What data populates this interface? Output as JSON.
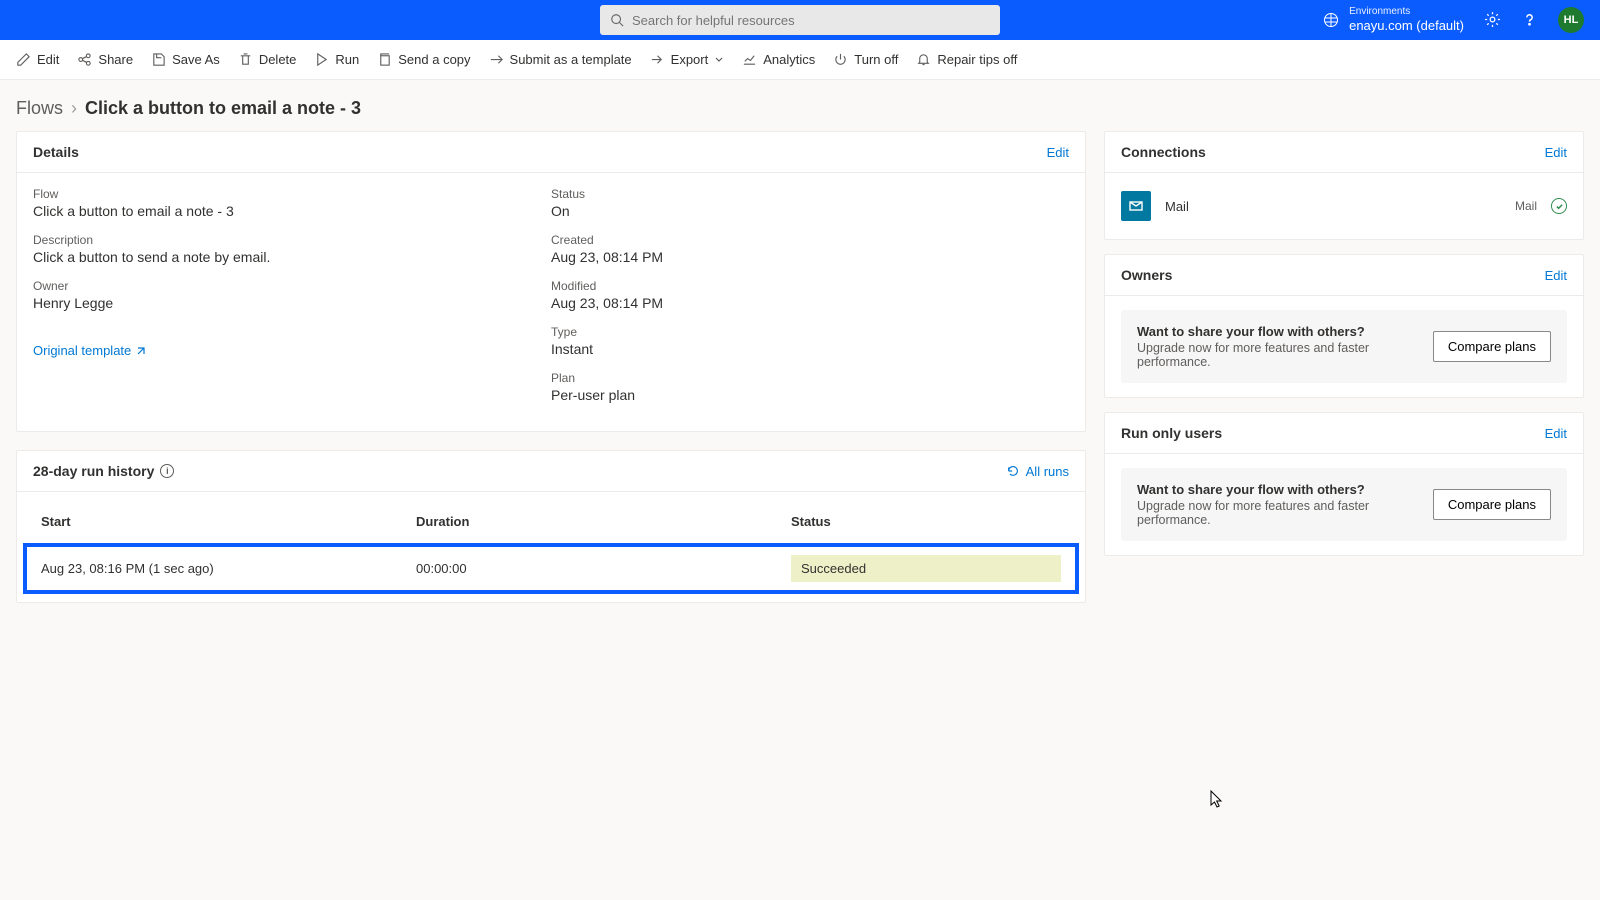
{
  "topbar": {
    "search_placeholder": "Search for helpful resources",
    "env_label": "Environments",
    "env_name": "enayu.com (default)",
    "avatar_initials": "HL"
  },
  "toolbar": {
    "edit": "Edit",
    "share": "Share",
    "save_as": "Save As",
    "delete": "Delete",
    "run": "Run",
    "send_copy": "Send a copy",
    "submit_template": "Submit as a template",
    "export": "Export",
    "analytics": "Analytics",
    "turn_off": "Turn off",
    "repair_tips": "Repair tips off"
  },
  "breadcrumb": {
    "root": "Flows",
    "current": "Click a button to email a note - 3"
  },
  "details": {
    "header": "Details",
    "edit": "Edit",
    "flow_label": "Flow",
    "flow_value": "Click a button to email a note - 3",
    "desc_label": "Description",
    "desc_value": "Click a button to send a note by email.",
    "owner_label": "Owner",
    "owner_value": "Henry Legge",
    "status_label": "Status",
    "status_value": "On",
    "created_label": "Created",
    "created_value": "Aug 23, 08:14 PM",
    "modified_label": "Modified",
    "modified_value": "Aug 23, 08:14 PM",
    "type_label": "Type",
    "type_value": "Instant",
    "plan_label": "Plan",
    "plan_value": "Per-user plan",
    "original_template": "Original template"
  },
  "run_history": {
    "header": "28-day run history",
    "all_runs": "All runs",
    "col_start": "Start",
    "col_duration": "Duration",
    "col_status": "Status",
    "row": {
      "start": "Aug 23, 08:16 PM (1 sec ago)",
      "duration": "00:00:00",
      "status": "Succeeded"
    }
  },
  "connections": {
    "header": "Connections",
    "edit": "Edit",
    "item_name": "Mail",
    "item_type": "Mail"
  },
  "owners": {
    "header": "Owners",
    "edit": "Edit",
    "promo_title": "Want to share your flow with others?",
    "promo_desc": "Upgrade now for more features and faster performance.",
    "promo_btn": "Compare plans"
  },
  "run_only": {
    "header": "Run only users",
    "edit": "Edit",
    "promo_title": "Want to share your flow with others?",
    "promo_desc": "Upgrade now for more features and faster performance.",
    "promo_btn": "Compare plans"
  }
}
